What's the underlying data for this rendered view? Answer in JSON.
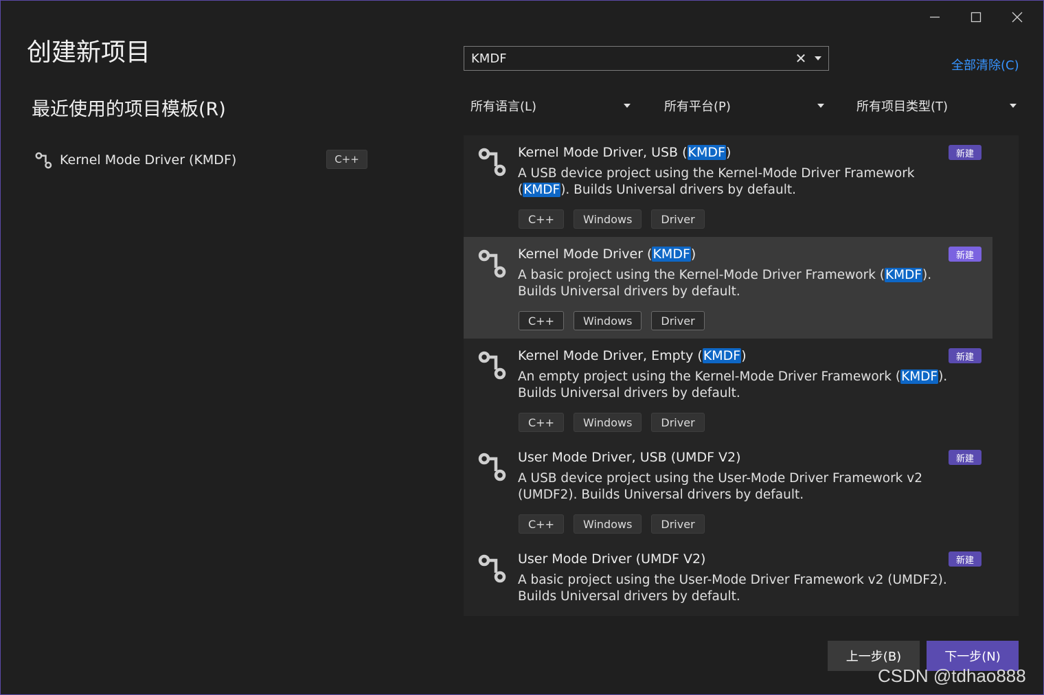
{
  "window": {
    "title": "创建新项目",
    "controls": [
      "minimize-icon",
      "maximize-icon",
      "close-icon"
    ]
  },
  "recent": {
    "heading": "最近使用的项目模板(R)",
    "items": [
      {
        "name": "Kernel Mode Driver (KMDF)",
        "badge": "C++",
        "icon": "driver-icon"
      }
    ]
  },
  "search": {
    "value": "KMDF",
    "clear_symbol": "✕"
  },
  "clear_all_label": "全部清除(C)",
  "filters": {
    "language": "所有语言(L)",
    "platform": "所有平台(P)",
    "project_type": "所有项目类型(T)"
  },
  "results": [
    {
      "name_before": "Kernel Mode Driver, USB (",
      "name_highlight": "KMDF",
      "name_after": ")",
      "desc_before": "A USB device project using the Kernel-Mode Driver Framework (",
      "desc_highlight": "KMDF",
      "desc_after": "). Builds Universal drivers by default.",
      "badge": "新建",
      "tags": [
        "C++",
        "Windows",
        "Driver"
      ],
      "selected": false
    },
    {
      "name_before": "Kernel Mode Driver (",
      "name_highlight": "KMDF",
      "name_after": ")",
      "desc_before": "A basic project using the Kernel-Mode Driver Framework (",
      "desc_highlight": "KMDF",
      "desc_after": "). Builds Universal drivers by default.",
      "badge": "新建",
      "tags": [
        "C++",
        "Windows",
        "Driver"
      ],
      "selected": true
    },
    {
      "name_before": "Kernel Mode Driver, Empty (",
      "name_highlight": "KMDF",
      "name_after": ")",
      "desc_before": "An empty project using the Kernel-Mode Driver Framework (",
      "desc_highlight": "KMDF",
      "desc_after": "). Builds Universal drivers by default.",
      "badge": "新建",
      "tags": [
        "C++",
        "Windows",
        "Driver"
      ],
      "selected": false
    },
    {
      "name_before": "User Mode Driver, USB (UMDF V2)",
      "name_highlight": "",
      "name_after": "",
      "desc_before": "A USB device project using the User-Mode Driver Framework v2 (UMDF2). Builds Universal drivers by default.",
      "desc_highlight": "",
      "desc_after": "",
      "badge": "新建",
      "tags": [
        "C++",
        "Windows",
        "Driver"
      ],
      "selected": false
    },
    {
      "name_before": "User Mode Driver (UMDF V2)",
      "name_highlight": "",
      "name_after": "",
      "desc_before": "A basic project using the User-Mode Driver Framework v2 (UMDF2). Builds Universal drivers by default.",
      "desc_highlight": "",
      "desc_after": "",
      "badge": "新建",
      "tags": [],
      "selected": false
    }
  ],
  "buttons": {
    "back": "上一步(B)",
    "next": "下一步(N)"
  },
  "watermark": "CSDN @tdhao888",
  "colors": {
    "accent": "#5a4bb0",
    "highlight": "#0e67c6",
    "link": "#3794ff"
  }
}
